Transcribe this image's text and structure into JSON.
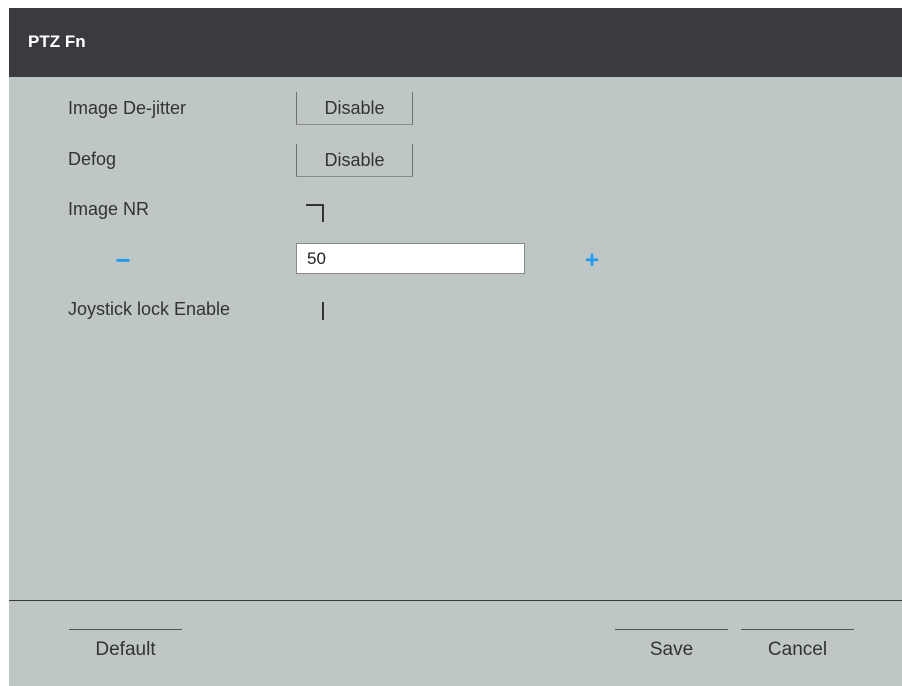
{
  "dialog": {
    "title": "PTZ Fn"
  },
  "settings": {
    "image_dejitter": {
      "label": "Image De-jitter",
      "value": "Disable"
    },
    "defog": {
      "label": "Defog",
      "value": "Disable"
    },
    "image_nr": {
      "label": "Image NR",
      "checked": false
    },
    "nr_level": {
      "minus": "−",
      "value": "50",
      "plus": "+"
    },
    "joystick_lock": {
      "label": "Joystick lock Enable"
    }
  },
  "footer": {
    "default_label": "Default",
    "save_label": "Save",
    "cancel_label": "Cancel"
  },
  "colors": {
    "titlebar": "#3a3a40",
    "panel": "#bec6c6",
    "accent": "#1f9bf0"
  }
}
